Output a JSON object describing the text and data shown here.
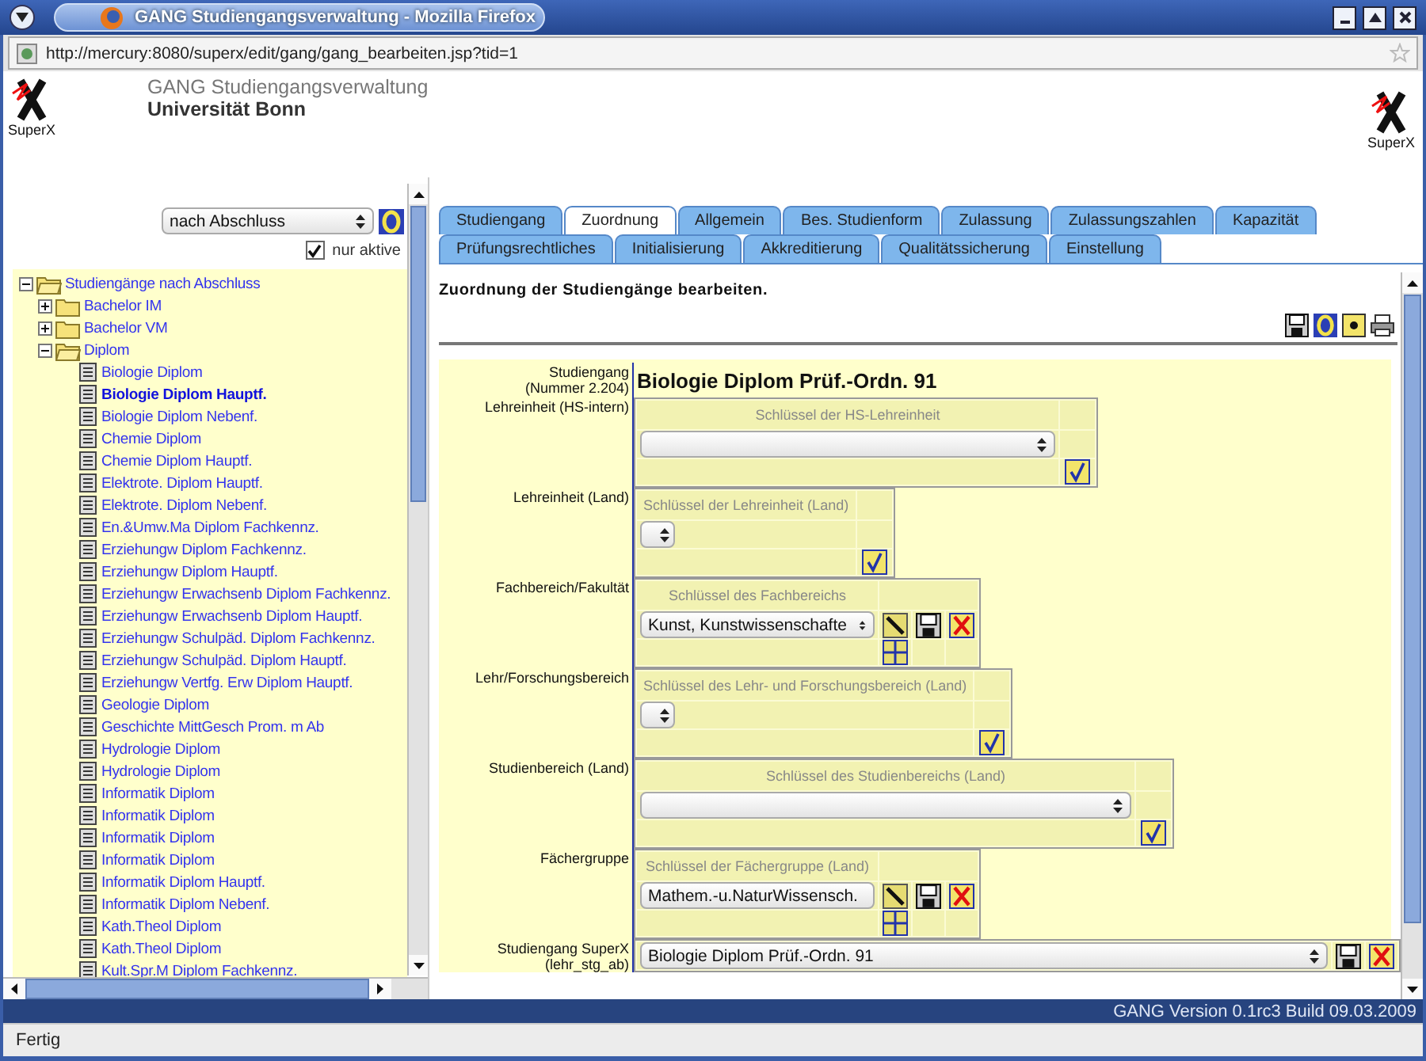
{
  "window": {
    "title": "GANG Studiengangsverwaltung - Mozilla Firefox"
  },
  "address_bar": {
    "url": "http://mercury:8080/superx/edit/gang/gang_bearbeiten.jsp?tid=1"
  },
  "header": {
    "logo_caption": "SuperX",
    "app_title": "GANG Studiengangsverwaltung",
    "university": "Universität Bonn",
    "right_logo_caption": "SuperX"
  },
  "sidebar": {
    "view_select": {
      "value": "nach Abschluss"
    },
    "only_active": {
      "label": "nur aktive",
      "checked": true
    },
    "tree": [
      {
        "kind": "folder",
        "label": "Studiengänge nach Abschluss",
        "expanded": true,
        "selected": false,
        "children": [
          {
            "kind": "folder",
            "label": "Bachelor IM",
            "expanded": false,
            "selected": false
          },
          {
            "kind": "folder",
            "label": "Bachelor VM",
            "expanded": false,
            "selected": false
          },
          {
            "kind": "folder",
            "label": "Diplom",
            "expanded": true,
            "selected": false,
            "children": [
              {
                "kind": "document",
                "label": "Biologie Diplom",
                "selected": false
              },
              {
                "kind": "document",
                "label": "Biologie Diplom Hauptf.",
                "selected": true
              },
              {
                "kind": "document",
                "label": "Biologie Diplom Nebenf.",
                "selected": false
              },
              {
                "kind": "document",
                "label": "Chemie Diplom",
                "selected": false
              },
              {
                "kind": "document",
                "label": "Chemie Diplom Hauptf.",
                "selected": false
              },
              {
                "kind": "document",
                "label": "Elektrote. Diplom Hauptf.",
                "selected": false
              },
              {
                "kind": "document",
                "label": "Elektrote. Diplom Nebenf.",
                "selected": false
              },
              {
                "kind": "document",
                "label": "En.&Umw.Ma Diplom Fachkennz.",
                "selected": false
              },
              {
                "kind": "document",
                "label": "Erziehungw Diplom Fachkennz.",
                "selected": false
              },
              {
                "kind": "document",
                "label": "Erziehungw Diplom Hauptf.",
                "selected": false
              },
              {
                "kind": "document",
                "label": "Erziehungw Erwachsenb Diplom Fachkennz.",
                "selected": false
              },
              {
                "kind": "document",
                "label": "Erziehungw Erwachsenb Diplom Hauptf.",
                "selected": false
              },
              {
                "kind": "document",
                "label": "Erziehungw Schulpäd. Diplom Fachkennz.",
                "selected": false
              },
              {
                "kind": "document",
                "label": "Erziehungw Schulpäd. Diplom Hauptf.",
                "selected": false
              },
              {
                "kind": "document",
                "label": "Erziehungw Vertfg. Erw Diplom Hauptf.",
                "selected": false
              },
              {
                "kind": "document",
                "label": "Geologie Diplom",
                "selected": false
              },
              {
                "kind": "document",
                "label": "Geschichte MittGesch Prom. m Ab",
                "selected": false
              },
              {
                "kind": "document",
                "label": "Hydrologie Diplom",
                "selected": false
              },
              {
                "kind": "document",
                "label": "Hydrologie Diplom",
                "selected": false
              },
              {
                "kind": "document",
                "label": "Informatik Diplom",
                "selected": false
              },
              {
                "kind": "document",
                "label": "Informatik Diplom",
                "selected": false
              },
              {
                "kind": "document",
                "label": "Informatik Diplom",
                "selected": false
              },
              {
                "kind": "document",
                "label": "Informatik Diplom",
                "selected": false
              },
              {
                "kind": "document",
                "label": "Informatik Diplom Hauptf.",
                "selected": false
              },
              {
                "kind": "document",
                "label": "Informatik Diplom Nebenf.",
                "selected": false
              },
              {
                "kind": "document",
                "label": "Kath.Theol Diplom",
                "selected": false
              },
              {
                "kind": "document",
                "label": "Kath.Theol Diplom",
                "selected": false
              },
              {
                "kind": "document",
                "label": "Kult.Spr.M Diplom Fachkennz.",
                "selected": false
              }
            ]
          }
        ]
      }
    ]
  },
  "tab_rows": [
    {
      "tabs": [
        {
          "label": "Studiengang",
          "selected": false
        },
        {
          "label": "Zuordnung",
          "selected": true
        },
        {
          "label": "Allgemein",
          "selected": false
        },
        {
          "label": "Bes. Studienform",
          "selected": false
        },
        {
          "label": "Zulassung",
          "selected": false
        },
        {
          "label": "Zulassungszahlen",
          "selected": false
        },
        {
          "label": "Kapazität",
          "selected": false
        }
      ]
    },
    {
      "tabs": [
        {
          "label": "Prüfungsrechtliches",
          "selected": false
        },
        {
          "label": "Initialisierung",
          "selected": false
        },
        {
          "label": "Akkreditierung",
          "selected": false
        },
        {
          "label": "Qualitätssicherung",
          "selected": false
        },
        {
          "label": "Einstellung",
          "selected": false
        }
      ]
    }
  ],
  "page": {
    "heading": "Zuordnung der Studiengänge bearbeiten.",
    "form": [
      {
        "kind": "title",
        "label": "Studiengang",
        "sublabel": "(Nummer 2.204)",
        "value": "Biologie Diplom Prüf.-Ordn. 91"
      },
      {
        "kind": "check",
        "label": "Lehreinheit (HS-intern)",
        "header": "Schlüssel der HS-Lehreinheit",
        "select": {
          "kind": "wide"
        }
      },
      {
        "kind": "check",
        "label": "Lehreinheit (Land)",
        "header": "Schlüssel der Lehreinheit (Land)",
        "select": {
          "kind": "tiny"
        }
      },
      {
        "kind": "edit",
        "label": "Fachbereich/Fakultät",
        "header": "Schlüssel des Fachbereichs",
        "select": {
          "kind": "medium",
          "value": "Kunst, Kunstwissenschafte"
        }
      },
      {
        "kind": "check",
        "label": "Lehr/Forschungsbereich",
        "header": "Schlüssel des Lehr- und Forschungsbereich (Land)",
        "select": {
          "kind": "tiny"
        }
      },
      {
        "kind": "check",
        "label": "Studienbereich (Land)",
        "header": "Schlüssel des Studienbereichs (Land)",
        "select": {
          "kind": "wider"
        }
      },
      {
        "kind": "edit",
        "label": "Fächergruppe",
        "header": "Schlüssel der Fächergruppe (Land)",
        "select": {
          "kind": "medium",
          "value": "Mathem.-u.NaturWissensch."
        }
      },
      {
        "kind": "link",
        "label": "Studiengang SuperX",
        "sublabel": "(lehr_stg_ab)",
        "select": {
          "kind": "full",
          "value": "Biologie Diplom Prüf.-Ordn. 91"
        }
      }
    ]
  },
  "footer": {
    "version": "GANG Version 0.1rc3 Build 09.03.2009"
  },
  "status_bar": {
    "text": "Fertig"
  }
}
